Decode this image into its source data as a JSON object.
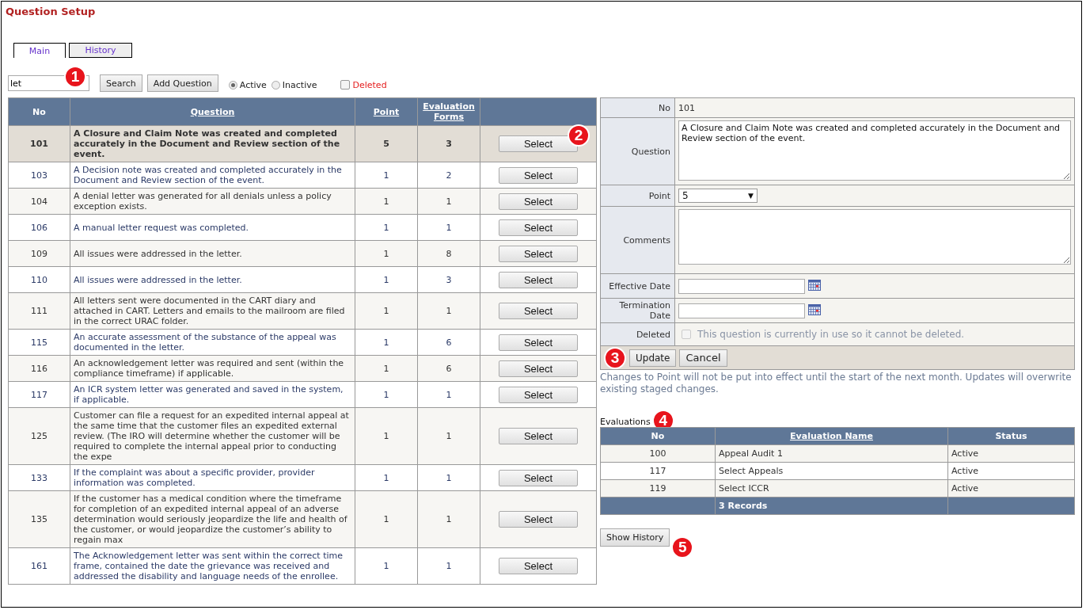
{
  "title": "Question Setup",
  "tabs": [
    {
      "label": "Main",
      "selected": true
    },
    {
      "label": "History",
      "selected": false
    }
  ],
  "toolbar": {
    "search_value": "let",
    "search_button": "Search",
    "add_button": "Add Question",
    "filters": [
      {
        "kind": "radio",
        "label": "Active",
        "checked": true
      },
      {
        "kind": "radio",
        "label": "Inactive",
        "checked": false
      },
      {
        "kind": "checkbox",
        "label": "Deleted",
        "checked": false
      }
    ]
  },
  "table": {
    "columns": [
      {
        "label": "No",
        "link": false
      },
      {
        "label": "Question",
        "link": true
      },
      {
        "label": "Point",
        "link": true
      },
      {
        "label": "Evaluation Forms",
        "link": true
      }
    ],
    "rows": [
      {
        "no": "101",
        "question": "A Closure and Claim Note was created and completed accurately in the Document and Review section of the event.",
        "point": "5",
        "forms": "3",
        "action": "Select",
        "selected": true
      },
      {
        "no": "103",
        "question": "A Decision note was created and completed accurately in the Document and Review section of the event.",
        "point": "1",
        "forms": "2",
        "action": "Select",
        "selected": false
      },
      {
        "no": "104",
        "question": "A denial letter was generated for all denials unless a policy exception exists.",
        "point": "1",
        "forms": "1",
        "action": "Select",
        "selected": false
      },
      {
        "no": "106",
        "question": "A manual letter request was completed.",
        "point": "1",
        "forms": "1",
        "action": "Select",
        "selected": false
      },
      {
        "no": "109",
        "question": "All issues were addressed in the letter.",
        "point": "1",
        "forms": "8",
        "action": "Select",
        "selected": false
      },
      {
        "no": "110",
        "question": "All issues were addressed in the letter.",
        "point": "1",
        "forms": "3",
        "action": "Select",
        "selected": false
      },
      {
        "no": "111",
        "question": "All letters sent were documented in the CART diary and attached in CART. Letters and emails to the mailroom are filed in the correct URAC folder.",
        "point": "1",
        "forms": "1",
        "action": "Select",
        "selected": false
      },
      {
        "no": "115",
        "question": "An accurate assessment of the substance of the appeal was documented in the letter.",
        "point": "1",
        "forms": "6",
        "action": "Select",
        "selected": false
      },
      {
        "no": "116",
        "question": "An acknowledgement letter was required and sent (within the compliance timeframe) if applicable.",
        "point": "1",
        "forms": "6",
        "action": "Select",
        "selected": false
      },
      {
        "no": "117",
        "question": "An ICR system letter was generated and saved in the system, if applicable.",
        "point": "1",
        "forms": "1",
        "action": "Select",
        "selected": false
      },
      {
        "no": "125",
        "question": "Customer can file a request for an expedited internal appeal at the same time that the customer files an expedited external review. (The IRO will determine whether the customer will be required to complete the internal appeal prior to conducting the expe",
        "point": "1",
        "forms": "1",
        "action": "Select",
        "selected": false
      },
      {
        "no": "133",
        "question": "If the complaint was about a specific provider, provider information was completed.",
        "point": "1",
        "forms": "1",
        "action": "Select",
        "selected": false
      },
      {
        "no": "135",
        "question": "If the customer has a medical condition where the timeframe for completion of an expedited internal appeal of an adverse determination would seriously jeopardize the life and health of the customer, or would jeopardize the customer’s ability to regain max",
        "point": "1",
        "forms": "1",
        "action": "Select",
        "selected": false
      },
      {
        "no": "161",
        "question": "The Acknowledgement letter was sent within the correct time frame, contained the date the grievance was received and addressed the disability and language needs of the enrollee.",
        "point": "1",
        "forms": "1",
        "action": "Select",
        "selected": false
      }
    ]
  },
  "detail": {
    "fields": [
      {
        "kind": "text",
        "label": "No",
        "value": "101"
      },
      {
        "kind": "textarea",
        "label": "Question",
        "value": "A Closure and Claim Note was created and completed accurately in the Document and Review section of the event."
      },
      {
        "kind": "select",
        "label": "Point",
        "value": "5",
        "caret": "▼"
      },
      {
        "kind": "textarea",
        "label": "Comments"
      },
      {
        "kind": "date",
        "label": "Effective Date"
      },
      {
        "kind": "date",
        "label": "Termination Date"
      },
      {
        "kind": "checkbox",
        "label": "Deleted",
        "checked": false,
        "disabled": true,
        "text": "This question is currently in use so it cannot be deleted."
      }
    ],
    "buttons": [
      "Update",
      "Cancel"
    ],
    "note": "Changes to Point will not be put into effect until the start of the next month. Updates will overwrite existing staged changes."
  },
  "evaluations": {
    "title": "Evaluations",
    "columns": [
      {
        "label": "No",
        "link": false
      },
      {
        "label": "Evaluation Name",
        "link": true
      },
      {
        "label": "Status",
        "link": false
      }
    ],
    "rows": [
      {
        "no": "100",
        "name": "Appeal Audit 1",
        "status": "Active"
      },
      {
        "no": "117",
        "name": "Select Appeals",
        "status": "Active"
      },
      {
        "no": "119",
        "name": "Select ICCR",
        "status": "Active"
      }
    ],
    "footer": "3 Records"
  },
  "show_history": "Show History",
  "callouts": [
    "1",
    "2",
    "3",
    "4",
    "5"
  ]
}
